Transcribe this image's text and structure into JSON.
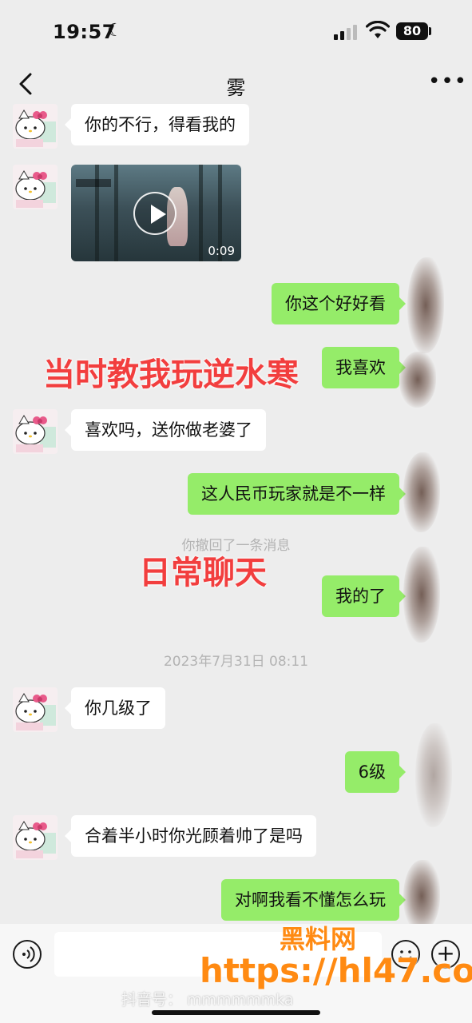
{
  "status_bar": {
    "time": "19:57",
    "battery": "80"
  },
  "nav": {
    "title": "雾"
  },
  "messages": [
    {
      "side": "left",
      "text": "你的不行，得看我的"
    },
    {
      "side": "left",
      "type": "video",
      "duration": "0:09"
    },
    {
      "side": "right",
      "text": "你这个好好看"
    },
    {
      "side": "right",
      "text": "我喜欢"
    },
    {
      "side": "left",
      "text": "喜欢吗，送你做老婆了"
    },
    {
      "side": "right",
      "text": "这人民币玩家就是不一样"
    },
    {
      "side": "system",
      "text": "你撤回了一条消息"
    },
    {
      "side": "right",
      "text": "我的了"
    },
    {
      "side": "system",
      "text": "2023年7月31日 08:11"
    },
    {
      "side": "left",
      "text": "你几级了"
    },
    {
      "side": "right",
      "text": "6级"
    },
    {
      "side": "left",
      "text": "合着半小时你光顾着帅了是吗"
    },
    {
      "side": "right",
      "text": "对啊我看不懂怎么玩"
    }
  ],
  "overlays": {
    "caption_1": "当时教我玩逆水寒",
    "caption_2": "日常聊天",
    "watermark_site_1": "黑料网",
    "watermark_site_2": "https://hl47.co",
    "douyin_id": "抖音号： mmmmmmka"
  },
  "colors": {
    "background": "#ededed",
    "bubble_self": "#95ec69",
    "bubble_other": "#ffffff",
    "caption_red": "#f23e3e",
    "watermark_orange": "#ff8a12"
  },
  "icons": {
    "back": "chevron-left-icon",
    "more": "more-dots-icon",
    "voice": "voice-icon",
    "emoji": "emoji-icon",
    "plus": "plus-icon",
    "play": "play-icon"
  }
}
